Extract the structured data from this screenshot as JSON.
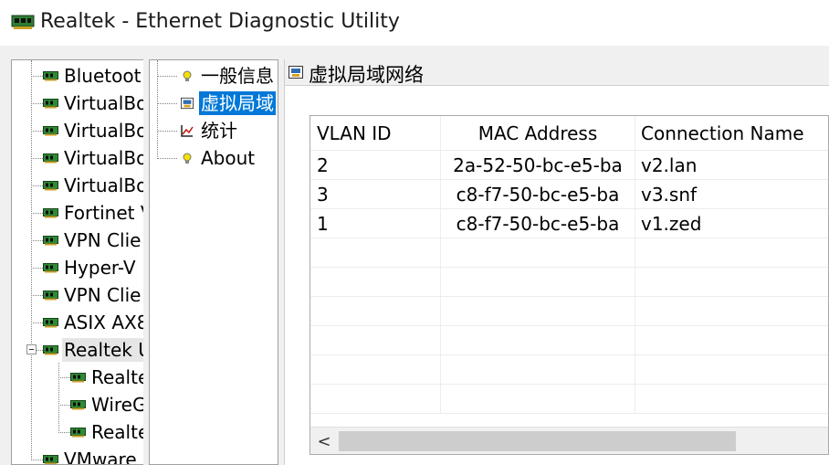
{
  "window": {
    "title": "Realtek - Ethernet Diagnostic Utility"
  },
  "device_tree": {
    "items": [
      {
        "label": "Bluetoot"
      },
      {
        "label": "VirtualBo"
      },
      {
        "label": "VirtualBo"
      },
      {
        "label": "VirtualBo"
      },
      {
        "label": "VirtualBo"
      },
      {
        "label": "Fortinet V"
      },
      {
        "label": "VPN Clie"
      },
      {
        "label": "Hyper-V"
      },
      {
        "label": "VPN Clie"
      },
      {
        "label": "ASIX AX8"
      },
      {
        "label": "Realtek U"
      },
      {
        "label": "Realte"
      },
      {
        "label": "WireG"
      },
      {
        "label": "Realte"
      },
      {
        "label": "VMware"
      }
    ]
  },
  "categories": {
    "items": [
      {
        "label": "一般信息",
        "icon": "bulb-icon"
      },
      {
        "label": "虚拟局域",
        "icon": "vlan-icon"
      },
      {
        "label": "统计",
        "icon": "stats-icon"
      },
      {
        "label": "About",
        "icon": "bulb-icon"
      }
    ]
  },
  "content": {
    "header_title": "虚拟局域网络"
  },
  "vlan_table": {
    "columns": [
      "VLAN ID",
      "MAC Address",
      "Connection Name"
    ],
    "rows": [
      {
        "vlan_id": "2",
        "mac": "2a-52-50-bc-e5-ba",
        "name": "v2.lan"
      },
      {
        "vlan_id": "3",
        "mac": "c8-f7-50-bc-e5-ba",
        "name": "v3.snf"
      },
      {
        "vlan_id": "1",
        "mac": "c8-f7-50-bc-e5-ba",
        "name": "v1.zed"
      }
    ]
  },
  "scrollbar": {
    "left_arrow": "<"
  },
  "colors": {
    "selection": "#0078d7",
    "panel_bg": "#f0f0f0"
  }
}
